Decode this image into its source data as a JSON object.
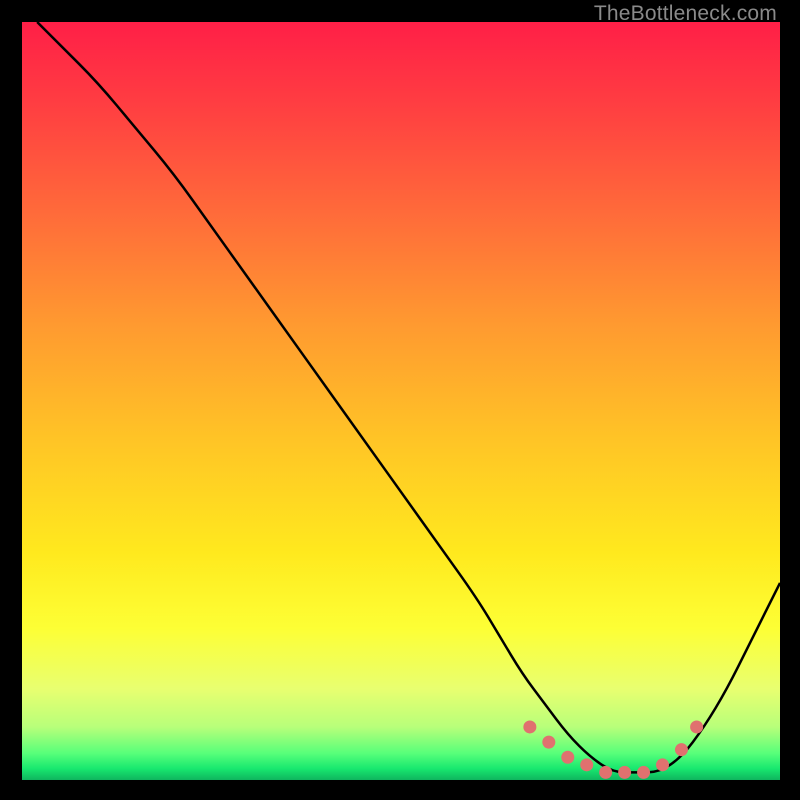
{
  "watermark": "TheBottleneck.com",
  "chart_data": {
    "type": "line",
    "title": "",
    "xlabel": "",
    "ylabel": "",
    "xlim": [
      0,
      100
    ],
    "ylim": [
      0,
      100
    ],
    "grid": false,
    "legend": false,
    "gradient_stops": [
      {
        "offset": 0.0,
        "color": "#ff1f47"
      },
      {
        "offset": 0.1,
        "color": "#ff3b42"
      },
      {
        "offset": 0.25,
        "color": "#ff6a3a"
      },
      {
        "offset": 0.4,
        "color": "#ff9a30"
      },
      {
        "offset": 0.55,
        "color": "#ffc426"
      },
      {
        "offset": 0.7,
        "color": "#ffe91e"
      },
      {
        "offset": 0.8,
        "color": "#fdff35"
      },
      {
        "offset": 0.88,
        "color": "#e8ff70"
      },
      {
        "offset": 0.93,
        "color": "#b8ff7a"
      },
      {
        "offset": 0.965,
        "color": "#57ff7a"
      },
      {
        "offset": 0.985,
        "color": "#18e86f"
      },
      {
        "offset": 1.0,
        "color": "#0fb55e"
      }
    ],
    "series": [
      {
        "name": "bottleneck-curve",
        "color": "#000000",
        "x": [
          2,
          5,
          10,
          15,
          20,
          25,
          30,
          35,
          40,
          45,
          50,
          55,
          60,
          63,
          66,
          69,
          72,
          75,
          78,
          81,
          84,
          87,
          90,
          93,
          96,
          100
        ],
        "y": [
          100,
          97,
          92,
          86,
          80,
          73,
          66,
          59,
          52,
          45,
          38,
          31,
          24,
          19,
          14,
          10,
          6,
          3,
          1,
          1,
          1,
          3,
          7,
          12,
          18,
          26
        ]
      },
      {
        "name": "optimal-range-dots",
        "type": "scatter",
        "color": "#e0716f",
        "x": [
          67,
          69.5,
          72,
          74.5,
          77,
          79.5,
          82,
          84.5,
          87,
          89
        ],
        "y": [
          7,
          5,
          3,
          2,
          1,
          1,
          1,
          2,
          4,
          7
        ]
      }
    ]
  }
}
